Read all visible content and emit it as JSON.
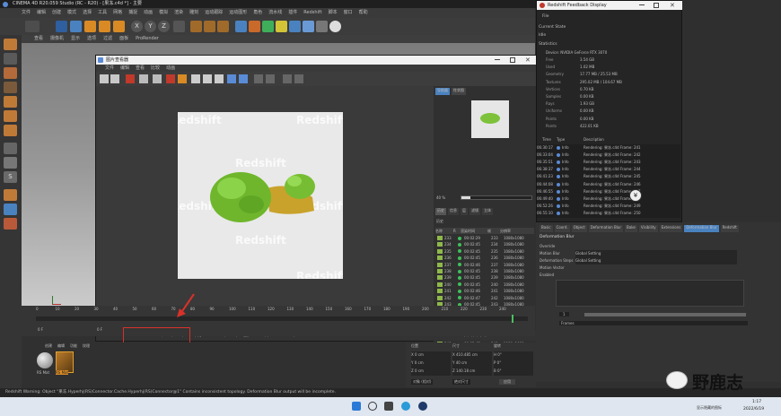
{
  "app": {
    "title": "CINEMA 4D R20.059 Studio (RC - R20) - [果冻.c4d *] - 主要"
  },
  "menubar": [
    "文件",
    "编辑",
    "创建",
    "模式",
    "选择",
    "工具",
    "网格",
    "捕捉",
    "动画",
    "模拟",
    "渲染",
    "雕刻",
    "运动跟踪",
    "运动图形",
    "角色",
    "流水线",
    "插件",
    "Redshift",
    "脚本",
    "窗口",
    "帮助"
  ],
  "viewport_menu": [
    "查看",
    "摄像机",
    "显示",
    "选项",
    "过滤",
    "面板",
    "ProRender"
  ],
  "picture_viewer": {
    "title": "图片查看器",
    "menu": [
      "文件",
      "编辑",
      "查看",
      "比较",
      "动画"
    ],
    "watermark": "Redshift",
    "tabs": [
      "导航器",
      "柱状图"
    ],
    "zoom": "40 %",
    "history_tabs": [
      "历史",
      "信息",
      "层",
      "滤镜",
      "立体"
    ],
    "history_label": "历史",
    "history_headers": [
      "名称",
      "R",
      "渲染时间",
      "帧",
      "分辨率"
    ],
    "history": [
      {
        "name": "233",
        "time": "00:02:29",
        "frame": "233",
        "res": "1080x1080"
      },
      {
        "name": "234",
        "time": "00:02:45",
        "frame": "234",
        "res": "1080x1080"
      },
      {
        "name": "235",
        "time": "00:02:45",
        "frame": "235",
        "res": "1080x1080"
      },
      {
        "name": "236",
        "time": "00:02:45",
        "frame": "236",
        "res": "1080x1080"
      },
      {
        "name": "237",
        "time": "00:02:46",
        "frame": "237",
        "res": "1080x1080"
      },
      {
        "name": "238",
        "time": "00:02:45",
        "frame": "238",
        "res": "1080x1080"
      },
      {
        "name": "239",
        "time": "00:02:45",
        "frame": "239",
        "res": "1080x1080"
      },
      {
        "name": "240",
        "time": "00:02:45",
        "frame": "240",
        "res": "1080x1080"
      },
      {
        "name": "241",
        "time": "00:02:46",
        "frame": "241",
        "res": "1080x1080"
      },
      {
        "name": "242",
        "time": "00:02:47",
        "frame": "242",
        "res": "1080x1080"
      },
      {
        "name": "243",
        "time": "00:02:45",
        "frame": "243",
        "res": "1080x1080"
      },
      {
        "name": "244",
        "time": "00:02:46",
        "frame": "244",
        "res": "1080x1080"
      },
      {
        "name": "245",
        "time": "00:02:45",
        "frame": "245",
        "res": "1080x1080"
      },
      {
        "name": "246",
        "time": "00:02:46",
        "frame": "246",
        "res": "1080x1080"
      },
      {
        "name": "247",
        "time": "00:02:45",
        "frame": "247",
        "res": "1080x1080"
      },
      {
        "name": "248",
        "time": "00:02:46",
        "frame": "248",
        "res": "1080x1080"
      },
      {
        "name": "249",
        "time": "00:02:45",
        "frame": "249",
        "res": "1080x1080"
      },
      {
        "name": "250",
        "time": "00:02:45",
        "frame": "250",
        "res": "1080x1080"
      },
      {
        "name": "251",
        "time": "00:02:45",
        "frame": "251",
        "res": "1080x1080"
      }
    ],
    "status_zoom": "40 %",
    "status_time": "07:10:56:251/251 (250 F)",
    "status_info": "尺寸: 1080x1080, RGB (16 位), 4.80 MB,  ( F 251 of 251 )",
    "frame_end": "250 F"
  },
  "timeline": {
    "ticks": [
      "0",
      "10",
      "20",
      "30",
      "40",
      "50",
      "60",
      "70",
      "80",
      "90",
      "100",
      "110",
      "120",
      "130",
      "140",
      "150",
      "160",
      "170",
      "180",
      "190",
      "200",
      "210",
      "220",
      "230",
      "240"
    ],
    "current_frame": "0 F",
    "end_field": "250 F",
    "start_field": "0 F",
    "right_frame": "250 F"
  },
  "materials": {
    "menu": [
      "创建",
      "编辑",
      "功能",
      "纹理"
    ],
    "items": [
      "RS Mat",
      "RS Mat"
    ]
  },
  "coords": {
    "headers": [
      "位置",
      "尺寸",
      "旋转"
    ],
    "rows": [
      {
        "pos": "X  0 cm",
        "size": "X  410.485 cm",
        "rot": "H  0°"
      },
      {
        "pos": "Y  0 cm",
        "size": "Y  40 cm",
        "rot": "P  0°"
      },
      {
        "pos": "Z  0 cm",
        "size": "Z  140.18 cm",
        "rot": "B  0°"
      }
    ],
    "mode_select": "对象 (相对)",
    "size_select": "绝对尺寸",
    "apply": "应用"
  },
  "redshift_feedback": {
    "title": "Redshift Feedback Display",
    "menu": "File",
    "current_state_label": "Current State",
    "current_state": "Idle",
    "statistics_label": "Statistics",
    "device": "Device: NVIDIA GeForce RTX 3070",
    "stats": [
      {
        "k": "Free",
        "v": "3.54 GB"
      },
      {
        "k": "Used",
        "v": "1.02 MB"
      },
      {
        "k": "Geometry",
        "v": "17.77 MB / 25.53 MB"
      },
      {
        "k": "Textures",
        "v": "295.02 MB / 104.67 MB"
      },
      {
        "k": "Vertices",
        "v": "0.70 KB"
      },
      {
        "k": "Samples",
        "v": "0.00 KB"
      },
      {
        "k": "Rays",
        "v": "1.93 GB"
      },
      {
        "k": "Uniforms",
        "v": "0.00 KB"
      },
      {
        "k": "Points",
        "v": "0.00 KB"
      },
      {
        "k": "Points",
        "v": "422.01 KB"
      }
    ],
    "log_headers": [
      "Time",
      "Type",
      "Description"
    ],
    "log": [
      {
        "time": "06:30:17",
        "type": "Info",
        "desc": "Rendering: 果冻.c4d Frame: 241"
      },
      {
        "time": "06:33:04",
        "type": "Info",
        "desc": "Rendering: 果冻.c4d Frame: 242"
      },
      {
        "time": "06:35:51",
        "type": "Info",
        "desc": "Rendering: 果冻.c4d Frame: 243"
      },
      {
        "time": "06:38:37",
        "type": "Info",
        "desc": "Rendering: 果冻.c4d Frame: 244"
      },
      {
        "time": "06:41:23",
        "type": "Info",
        "desc": "Rendering: 果冻.c4d Frame: 245"
      },
      {
        "time": "06:44:08",
        "type": "Info",
        "desc": "Rendering: 果冻.c4d Frame: 246"
      },
      {
        "time": "06:46:55",
        "type": "Info",
        "desc": "Rendering: 果冻.c4d Frame: 247"
      },
      {
        "time": "06:49:40",
        "type": "Info",
        "desc": "Rendering: 果冻.c4d Frame: 248"
      },
      {
        "time": "06:52:26",
        "type": "Info",
        "desc": "Rendering: 果冻.c4d Frame: 249"
      },
      {
        "time": "06:55:10",
        "type": "Info",
        "desc": "Rendering: 果冻.c4d Frame: 250"
      }
    ]
  },
  "attributes": {
    "tabs": [
      "Basic",
      "Coord.",
      "Object",
      "Deformation Blur",
      "Bake",
      "Visibility",
      "Extensions",
      "Deformation Blur",
      "Redshift"
    ],
    "section": "Deformation Blur",
    "rows": [
      {
        "label": "Override",
        "value": ""
      },
      {
        "label": "Motion Blur",
        "value": "Global Setting"
      },
      {
        "label": "Deformation Steps",
        "value": "Global Setting"
      },
      {
        "label": "Motion Vector",
        "value": ""
      },
      {
        "label": "Enabled",
        "value": ""
      }
    ],
    "spinner_value": "1",
    "select_value": "Frames"
  },
  "status_bar": "Redshift Warning: Object \"果冻.Hyperhj(RS)Connector.Cache.Hyperhj(RS)Connector@1\" Contains inconsistent topology. Deformation Blur output will be incomplete.",
  "taskbar": {
    "time": "1:17",
    "date": "2022/6/19",
    "tray": "显示隐藏的图标"
  },
  "wechat": {
    "name": "野鹿志"
  },
  "colors": {
    "accent": "#4a82c0",
    "annotation": "#d8322a",
    "render_green": "#7fc43a"
  }
}
